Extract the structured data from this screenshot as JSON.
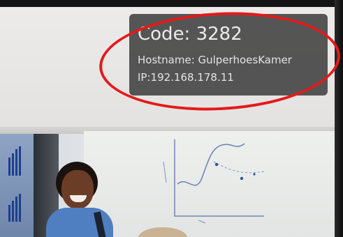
{
  "overlay": {
    "code_text": "Code: 3282",
    "hostname_text": "Hostname: GulperhoesKamer",
    "ip_text": "IP:192.168.178.11"
  },
  "colors": {
    "card_bg": "#484848",
    "card_text": "#ececec",
    "highlight_ellipse": "#e41a1a",
    "shirt": "#4f7fc0"
  }
}
